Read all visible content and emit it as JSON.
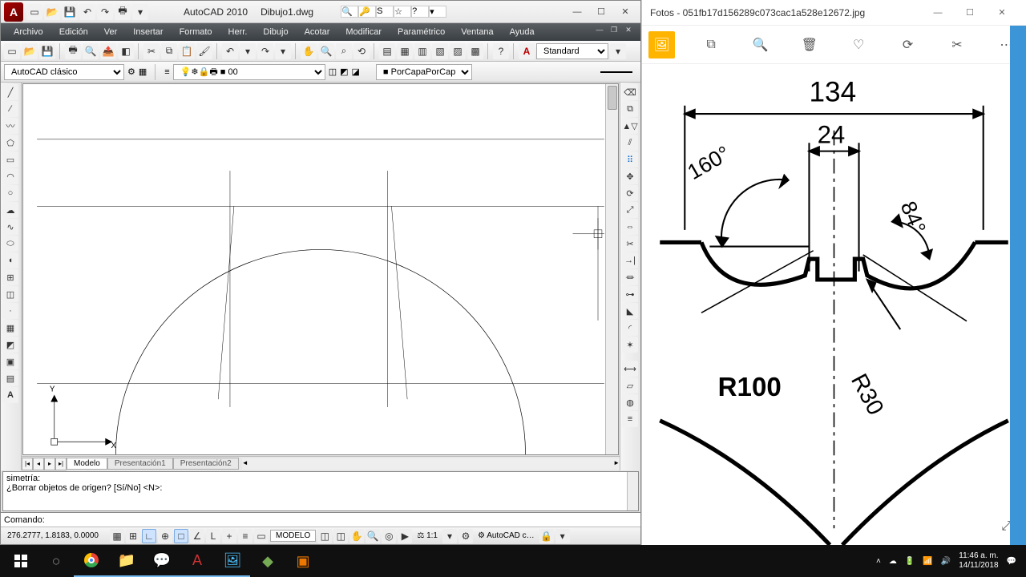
{
  "acad": {
    "app_name": "AutoCAD 2010",
    "file_name": "Dibujo1.dwg",
    "menus": [
      "Archivo",
      "Edición",
      "Ver",
      "Insertar",
      "Formato",
      "Herr.",
      "Dibujo",
      "Acotar",
      "Modificar",
      "Paramétrico",
      "Ventana",
      "Ayuda"
    ],
    "workspace": "AutoCAD clásico",
    "layer": "0",
    "color": "PorCapa",
    "textstyle": "Standard",
    "tabs": {
      "active": "Modelo",
      "others": [
        "Presentación1",
        "Presentación2"
      ]
    },
    "cmd": {
      "line1": "simetría:",
      "line2": "¿Borrar objetos de origen? [Sí/No] <N>:",
      "prompt": "Comando:"
    },
    "coords": "276.2777, 1.8183, 0.0000",
    "model_button": "MODELO",
    "scale": "1:1",
    "ws_status": "AutoCAD c…"
  },
  "photos": {
    "title": "Fotos - 051fb17d156289c073cac1a528e12672.jpg",
    "dims": {
      "d134": "134",
      "d24": "24",
      "a160": "160°",
      "a84": "84°",
      "r100": "R100",
      "r30": "R30"
    }
  },
  "taskbar": {
    "time": "11:46 a. m.",
    "date": "14/11/2018"
  }
}
